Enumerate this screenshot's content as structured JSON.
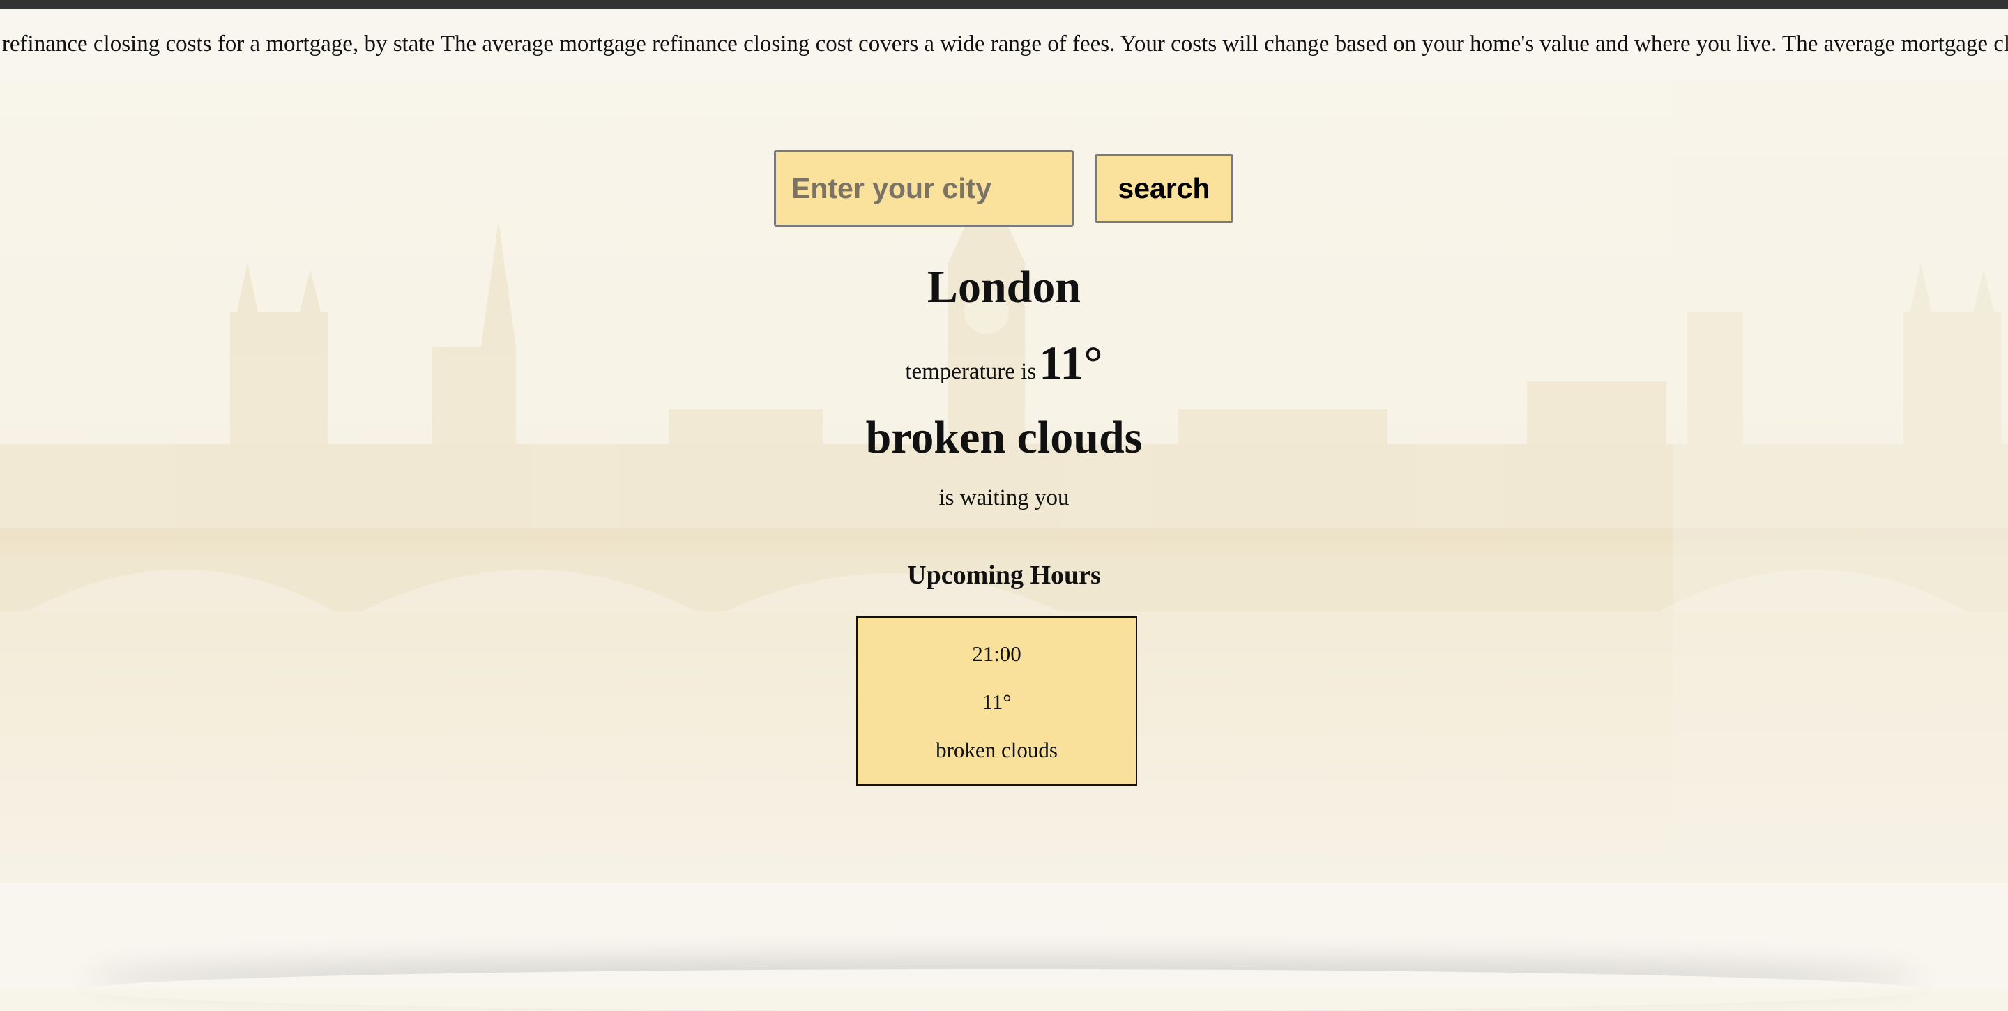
{
  "ticker": {
    "text": "e refinance closing costs for a mortgage, by state The average mortgage refinance closing cost covers a wide range of fees. Your costs will change based on your home's value and where you live. The average mortgage closing"
  },
  "search": {
    "placeholder": "Enter your city",
    "value": "",
    "button_label": "search"
  },
  "weather": {
    "city": "London",
    "temperature_label": "temperature is",
    "temperature": "11°",
    "description": "broken clouds",
    "waiting_text": "is waiting you"
  },
  "upcoming": {
    "title": "Upcoming Hours",
    "hours": [
      {
        "time": "21:00",
        "temp": "11°",
        "description": "broken clouds"
      }
    ]
  },
  "colors": {
    "accent_yellow": "#fbe29c",
    "top_bar": "#333333",
    "background": "#f7f4ea"
  }
}
